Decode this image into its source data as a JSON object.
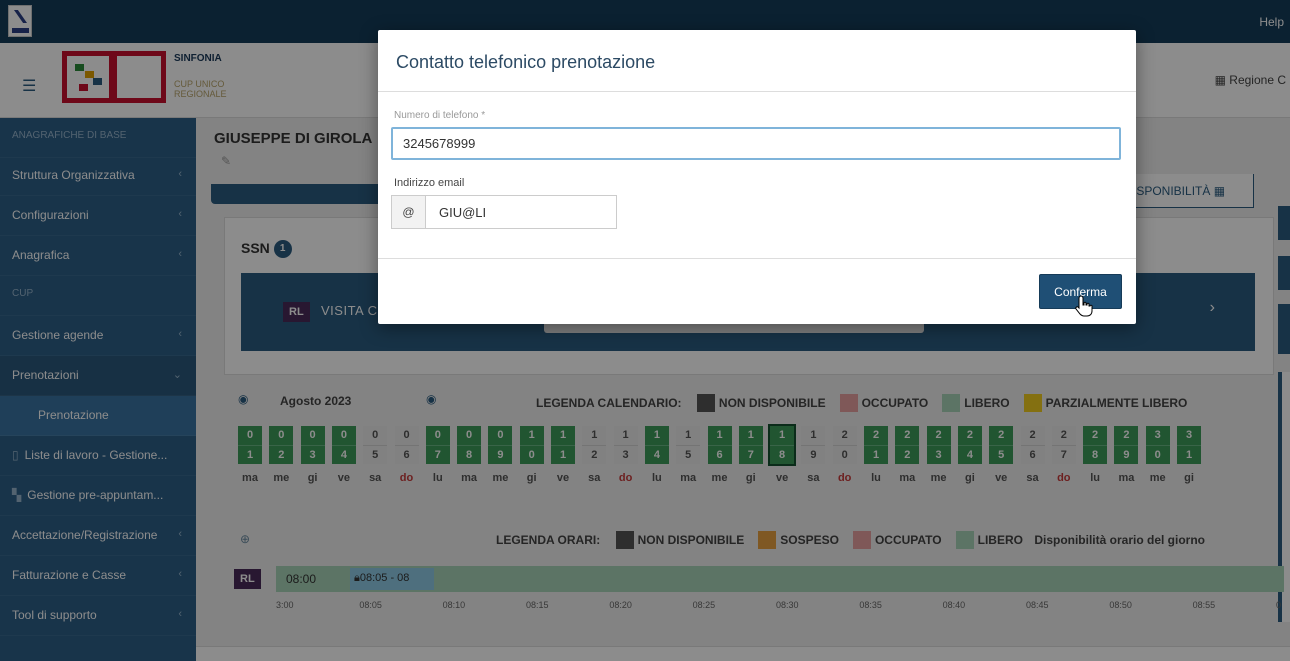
{
  "topbar": {
    "help": "Help"
  },
  "header": {
    "brand_name": "SINFONIA",
    "brand_sub": "CUP UNICO REGIONALE",
    "region": "Regione C"
  },
  "sidebar": {
    "items": [
      {
        "label": "ANAGRAFICHE DI BASE",
        "kind": "header"
      },
      {
        "label": "Struttura Organizzativa",
        "chevron": "‹"
      },
      {
        "label": "Configurazioni",
        "chevron": "‹"
      },
      {
        "label": "Anagrafica",
        "chevron": "‹"
      },
      {
        "label": "CUP",
        "kind": "header"
      },
      {
        "label": "Gestione agende",
        "chevron": "‹"
      },
      {
        "label": "Prenotazioni",
        "chevron": "⌄"
      },
      {
        "label": "Prenotazione",
        "kind": "sub"
      },
      {
        "label": "Liste di lavoro - Gestione..."
      },
      {
        "label": "Gestione pre-appuntam..."
      },
      {
        "label": "Accettazione/Registrazione",
        "chevron": "‹"
      },
      {
        "label": "Fatturazione e Casse",
        "chevron": "‹"
      },
      {
        "label": "Tool di supporto",
        "chevron": "‹"
      }
    ]
  },
  "main": {
    "patient_name": "GIUSEPPE DI GIROLA",
    "disponibilita": "ISPONIBILITÀ",
    "ssn_label": "SSN",
    "ssn_count": "1",
    "visita": {
      "tag": "RL",
      "text": "VISITA C"
    }
  },
  "calendar": {
    "month": "Agosto 2023",
    "legend_title": "LEGENDA CALENDARIO:",
    "legend": [
      {
        "label": "NON DISPONIBILE",
        "color": "#555555"
      },
      {
        "label": "OCCUPATO",
        "color": "#e8a0a0"
      },
      {
        "label": "LIBERO",
        "color": "#a8d4b8"
      },
      {
        "label": "PARZIALMENTE LIBERO",
        "color": "#f0cc20"
      }
    ],
    "days": [
      {
        "top": "0",
        "bottom": "1",
        "dow": "ma",
        "free": true
      },
      {
        "top": "0",
        "bottom": "2",
        "dow": "me",
        "free": true
      },
      {
        "top": "0",
        "bottom": "3",
        "dow": "gi",
        "free": true
      },
      {
        "top": "0",
        "bottom": "4",
        "dow": "ve",
        "free": true
      },
      {
        "top": "0",
        "bottom": "5",
        "dow": "sa",
        "free": false
      },
      {
        "top": "0",
        "bottom": "6",
        "dow": "do",
        "free": false
      },
      {
        "top": "0",
        "bottom": "7",
        "dow": "lu",
        "free": true
      },
      {
        "top": "0",
        "bottom": "8",
        "dow": "ma",
        "free": true
      },
      {
        "top": "0",
        "bottom": "9",
        "dow": "me",
        "free": true
      },
      {
        "top": "1",
        "bottom": "0",
        "dow": "gi",
        "free": true
      },
      {
        "top": "1",
        "bottom": "1",
        "dow": "ve",
        "free": true
      },
      {
        "top": "1",
        "bottom": "2",
        "dow": "sa",
        "free": false
      },
      {
        "top": "1",
        "bottom": "3",
        "dow": "do",
        "free": false
      },
      {
        "top": "1",
        "bottom": "4",
        "dow": "lu",
        "free": true
      },
      {
        "top": "1",
        "bottom": "5",
        "dow": "ma",
        "free": false
      },
      {
        "top": "1",
        "bottom": "6",
        "dow": "me",
        "free": true
      },
      {
        "top": "1",
        "bottom": "7",
        "dow": "gi",
        "free": true
      },
      {
        "top": "1",
        "bottom": "8",
        "dow": "ve",
        "free": true,
        "selected": true
      },
      {
        "top": "1",
        "bottom": "9",
        "dow": "sa",
        "free": false
      },
      {
        "top": "2",
        "bottom": "0",
        "dow": "do",
        "free": false
      },
      {
        "top": "2",
        "bottom": "1",
        "dow": "lu",
        "free": true
      },
      {
        "top": "2",
        "bottom": "2",
        "dow": "ma",
        "free": true
      },
      {
        "top": "2",
        "bottom": "3",
        "dow": "me",
        "free": true
      },
      {
        "top": "2",
        "bottom": "4",
        "dow": "gi",
        "free": true
      },
      {
        "top": "2",
        "bottom": "5",
        "dow": "ve",
        "free": true
      },
      {
        "top": "2",
        "bottom": "6",
        "dow": "sa",
        "free": false
      },
      {
        "top": "2",
        "bottom": "7",
        "dow": "do",
        "free": false
      },
      {
        "top": "2",
        "bottom": "8",
        "dow": "lu",
        "free": true
      },
      {
        "top": "2",
        "bottom": "9",
        "dow": "ma",
        "free": true
      },
      {
        "top": "3",
        "bottom": "0",
        "dow": "me",
        "free": true
      },
      {
        "top": "3",
        "bottom": "1",
        "dow": "gi",
        "free": true
      }
    ]
  },
  "schedule": {
    "legend_title": "LEGENDA ORARI:",
    "legend": [
      {
        "label": "NON DISPONIBILE",
        "color": "#555555"
      },
      {
        "label": "SOSPESO",
        "color": "#e8a040"
      },
      {
        "label": "OCCUPATO",
        "color": "#e8a0a0"
      },
      {
        "label": "LIBERO",
        "color": "#a8d4b8"
      }
    ],
    "day_note": "Disponibilità orario del giorno",
    "tag": "RL",
    "start_time": "08:00",
    "slot": "08:05 - 08",
    "ticks": [
      "3:00",
      "08:05",
      "08:10",
      "08:15",
      "08:20",
      "08:25",
      "08:30",
      "08:35",
      "08:40",
      "08:45",
      "08:50",
      "08:55",
      "0"
    ]
  },
  "modal": {
    "title": "Contatto telefonico prenotazione",
    "phone_label": "Numero di telefono *",
    "phone_value": "3245678999",
    "email_label": "Indirizzo email",
    "email_addon": "@",
    "email_value": "GIU@LI",
    "confirm_label": "Conferma"
  }
}
